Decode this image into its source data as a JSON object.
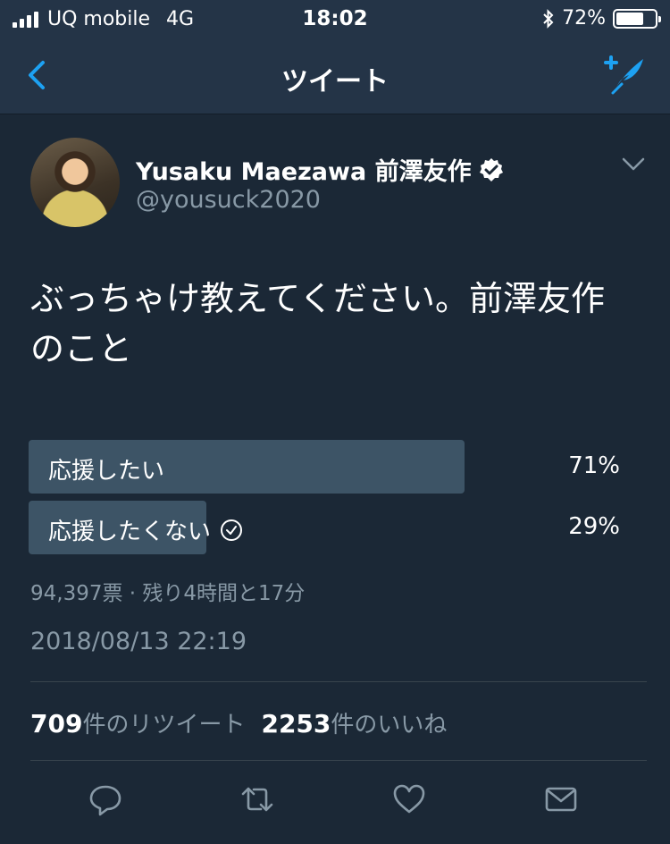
{
  "status_bar": {
    "carrier": "UQ mobile",
    "network": "4G",
    "time": "18:02",
    "battery_percent": "72%",
    "battery_level": 0.72
  },
  "nav": {
    "title": "ツイート",
    "back_icon": "chevron-left-icon",
    "compose_icon": "compose-tweet-icon"
  },
  "tweet": {
    "display_name": "Yusaku Maezawa 前澤友作",
    "handle": "@yousuck2020",
    "text": "ぶっちゃけ教えてください。前澤友作のこと",
    "poll": {
      "options": [
        {
          "label": "応援したい",
          "percent": "71%",
          "value": 0.71,
          "voted": false
        },
        {
          "label": "応援したくない",
          "percent": "29%",
          "value": 0.29,
          "voted": true
        }
      ],
      "meta": "94,397票 · 残り4時間と17分"
    },
    "timestamp": "2018/08/13 22:19",
    "stats": {
      "retweets_count": "709",
      "retweets_label": "件のリツイート",
      "likes_count": "2253",
      "likes_label": "件のいいね"
    }
  },
  "colors": {
    "background": "#1b2836",
    "header": "#243447",
    "accent": "#1da1f2",
    "muted": "#8899a6",
    "poll_bar": "#3d5466"
  }
}
